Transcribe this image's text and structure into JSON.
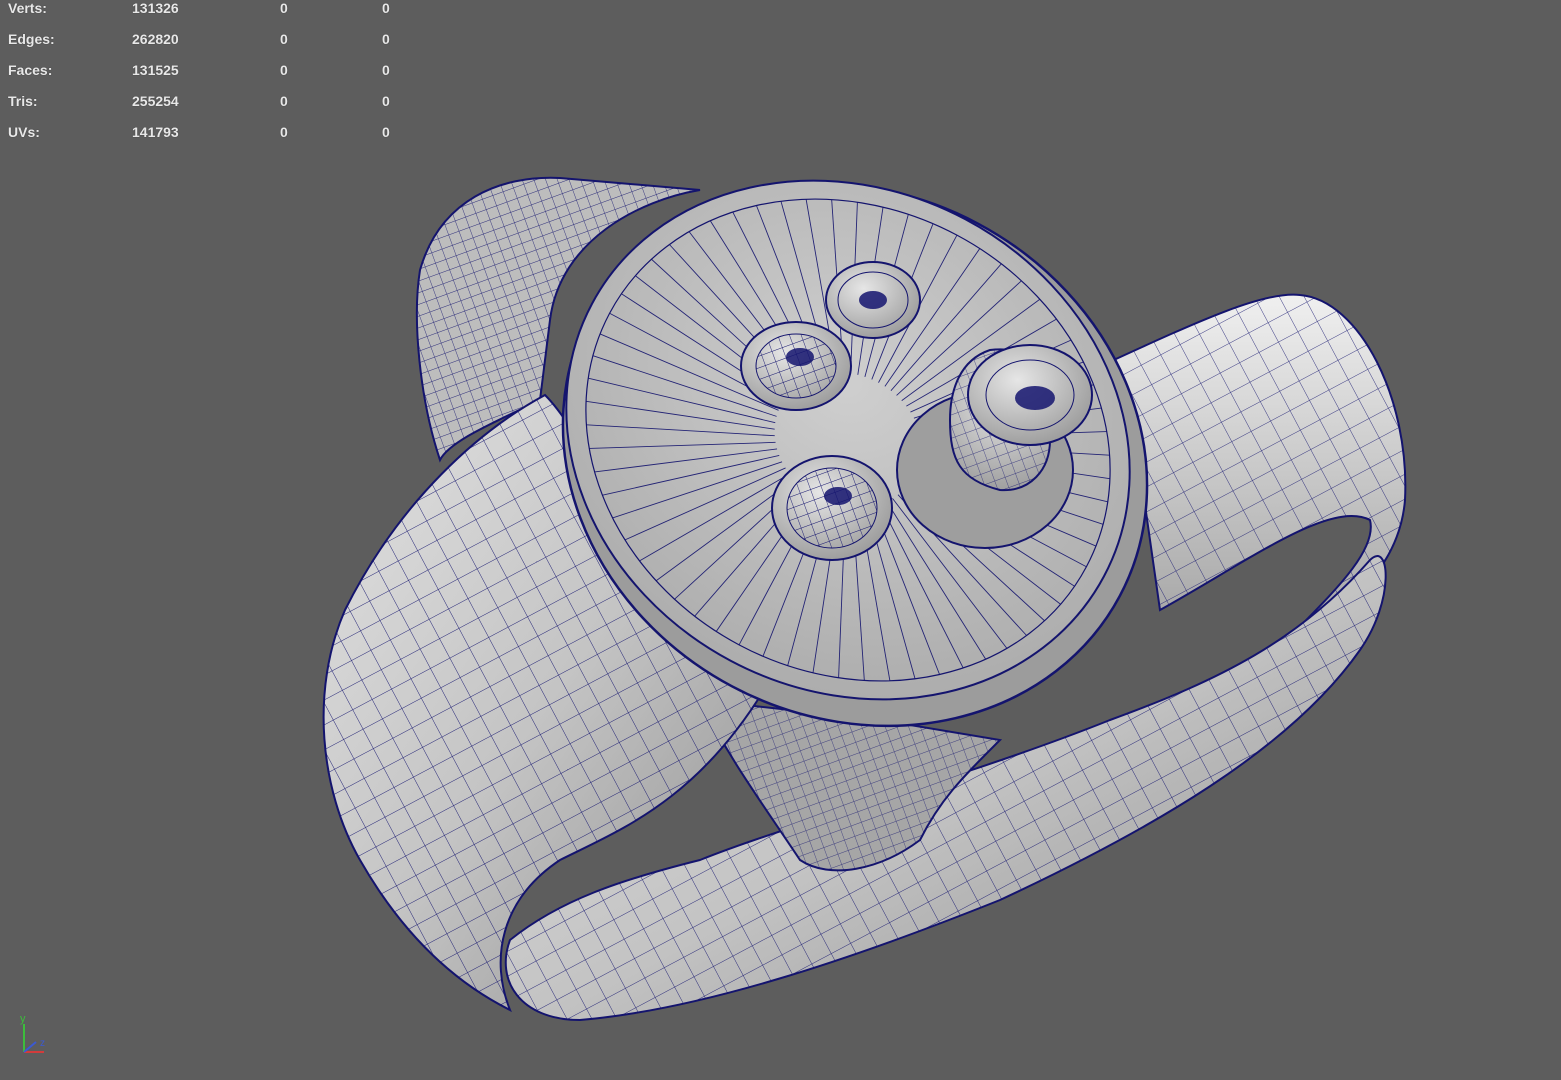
{
  "hud": {
    "rows": [
      {
        "label": "Verts:",
        "v1": "131326",
        "v2": "0",
        "v3": "0"
      },
      {
        "label": "Edges:",
        "v1": "262820",
        "v2": "0",
        "v3": "0"
      },
      {
        "label": "Faces:",
        "v1": "131525",
        "v2": "0",
        "v3": "0"
      },
      {
        "label": "Tris:",
        "v1": "255254",
        "v2": "0",
        "v3": "0"
      },
      {
        "label": "UVs:",
        "v1": "141793",
        "v2": "0",
        "v3": "0"
      }
    ]
  },
  "axis": {
    "y_label": "y",
    "z_label": "z"
  },
  "colors": {
    "viewport_bg": "#5d5d5d",
    "wireframe": "#14146e",
    "surface": "#c8c8c8",
    "axis_x": "#d23c3c",
    "axis_y": "#3cbd3c",
    "axis_z": "#3c5ad2"
  },
  "model": {
    "icon": "wireframe-controller-mesh",
    "display_mode": "wireframe-on-shaded"
  }
}
